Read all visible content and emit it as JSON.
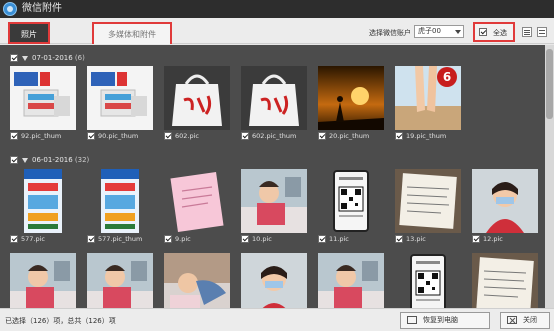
{
  "window": {
    "title": "微信附件"
  },
  "tabs": [
    {
      "label": "照片",
      "active": true
    },
    {
      "label": "多媒体和附件",
      "active": false
    }
  ],
  "account": {
    "label": "选择微信账户",
    "selected": "虎子00"
  },
  "select_all": {
    "label": "全选",
    "checked": true
  },
  "groups": [
    {
      "date": "07-01-2016",
      "count": "(6)",
      "checked": true
    },
    {
      "date": "06-01-2016",
      "count": "(32)",
      "checked": true
    }
  ],
  "row1": [
    {
      "name": "92.pic_thum",
      "kind": "product-box"
    },
    {
      "name": "90.pic_thum",
      "kind": "product-box"
    },
    {
      "name": "602.pic",
      "kind": "white-bag"
    },
    {
      "name": "602.pic_thum",
      "kind": "white-bag"
    },
    {
      "name": "20.pic_thum",
      "kind": "sunset-silhouette"
    },
    {
      "name": "19.pic_thum",
      "kind": "legs-badge",
      "badge": "6"
    }
  ],
  "row2": [
    {
      "name": "577.pic",
      "kind": "poster-blue"
    },
    {
      "name": "577.pic_thum",
      "kind": "poster-blue"
    },
    {
      "name": "9.pic",
      "kind": "pink-note"
    },
    {
      "name": "10.pic",
      "kind": "child-bed"
    },
    {
      "name": "11.pic",
      "kind": "qr-phone"
    },
    {
      "name": "13.pic",
      "kind": "paper-receipt"
    },
    {
      "name": "12.pic",
      "kind": "child-red"
    }
  ],
  "row3": [
    {
      "kind": "child-bed"
    },
    {
      "kind": "child-bed"
    },
    {
      "kind": "sleeping-child"
    },
    {
      "kind": "child-red"
    },
    {
      "kind": "child-bed"
    },
    {
      "kind": "qr-phone"
    },
    {
      "kind": "paper-receipt"
    }
  ],
  "status": {
    "text": "已选择（126）项，总共（126）项",
    "restore_label": "恢复到电脑",
    "close_label": "关闭"
  },
  "colors": {
    "accent_red": "#e03a3a",
    "titlebar": "#2d2d2d",
    "content_bg": "#4c4c4c"
  }
}
